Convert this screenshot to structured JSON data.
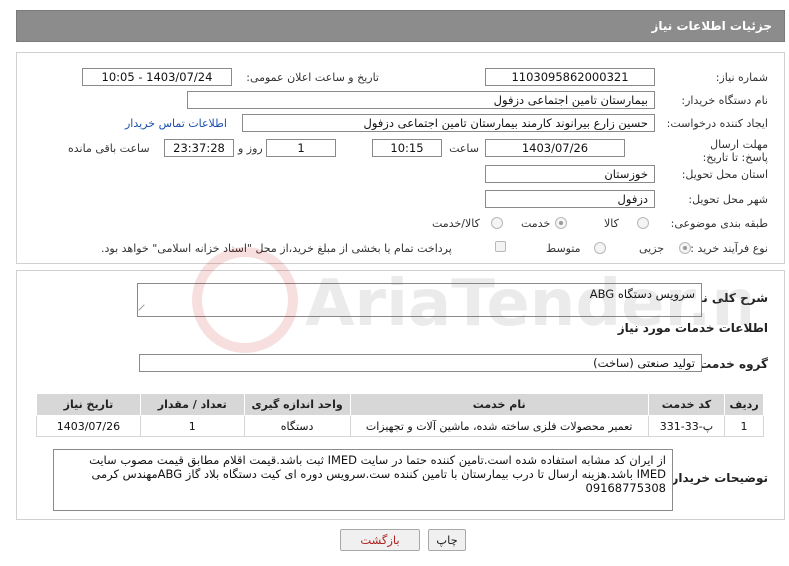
{
  "page": {
    "title": "جزئیات اطلاعات نیاز"
  },
  "info": {
    "need_number_label": "شماره نیاز:",
    "need_number": "1103095862000321",
    "announce_label": "تاریخ و ساعت اعلان عمومی:",
    "announce_value": "1403/07/24 - 10:05",
    "buyer_org_label": "نام دستگاه خریدار:",
    "buyer_org": "بیمارستان تامین اجتماعی دزفول",
    "creator_label": "ایجاد کننده درخواست:",
    "creator": "حسین زارع بیرانوند کارمند بیمارستان تامین اجتماعی دزفول",
    "contact_link": "اطلاعات تماس خریدار",
    "deadline_label": "مهلت ارسال پاسخ: تا تاریخ:",
    "deadline_date": "1403/07/26",
    "time_label": "ساعت",
    "deadline_time": "10:15",
    "days_value": "1",
    "days_label": "روز و",
    "remaining_time": "23:37:28",
    "remaining_label": "ساعت باقی مانده",
    "province_label": "استان محل تحویل:",
    "province": "خوزستان",
    "city_label": "شهر محل تحویل:",
    "city": "دزفول",
    "category_label": "طبقه بندی موضوعی:",
    "category_options": [
      "کالا",
      "خدمت",
      "کالا/خدمت"
    ],
    "category_selected": "خدمت",
    "process_label": "نوع فرآیند خرید :",
    "process_options": [
      "جزیی",
      "متوسط"
    ],
    "process_selected": "جزیی",
    "payment_note": "پرداخت تمام یا بخشی از مبلغ خرید،از محل \"اسناد خزانه اسلامی\" خواهد بود."
  },
  "need": {
    "summary_label": "شرح کلی نیاز:",
    "summary": "سرویس دستگاه ABG",
    "services_title": "اطلاعات خدمات مورد نیاز",
    "service_group_label": "گروه خدمت:",
    "service_group": "تولید صنعتی (ساخت)",
    "table": {
      "headers": [
        "ردیف",
        "کد خدمت",
        "نام خدمت",
        "واحد اندازه گیری",
        "تعداد / مقدار",
        "تاریخ نیاز"
      ],
      "rows": [
        [
          "1",
          "پ-33-331",
          "تعمیر محصولات فلزی ساخته شده، ماشین آلات و تجهیزات",
          "دستگاه",
          "1",
          "1403/07/26"
        ]
      ]
    },
    "buyer_notes_label": "توضیحات خریدار:",
    "buyer_notes": "از ایران کد مشابه استفاده شده است.تامین کننده حتما در سایت IMED ثبت باشد.قیمت اقلام مطابق قیمت مصوب سایت IMED  باشد.هزینه ارسال تا درب بیمارستان با تامین کننده ست.سرویس دوره ای کیت دستگاه بلاد گاز ABGمهندس کرمی 09168775308"
  },
  "buttons": {
    "print": "چاپ",
    "back": "بازگشت"
  },
  "watermark": {
    "text": "AriaTender.neT"
  },
  "colors": {
    "header_bg": "#8c8c8c",
    "table_header_bg": "#d7d7d7",
    "link": "#1a4fb0",
    "back_text": "#b02020"
  }
}
